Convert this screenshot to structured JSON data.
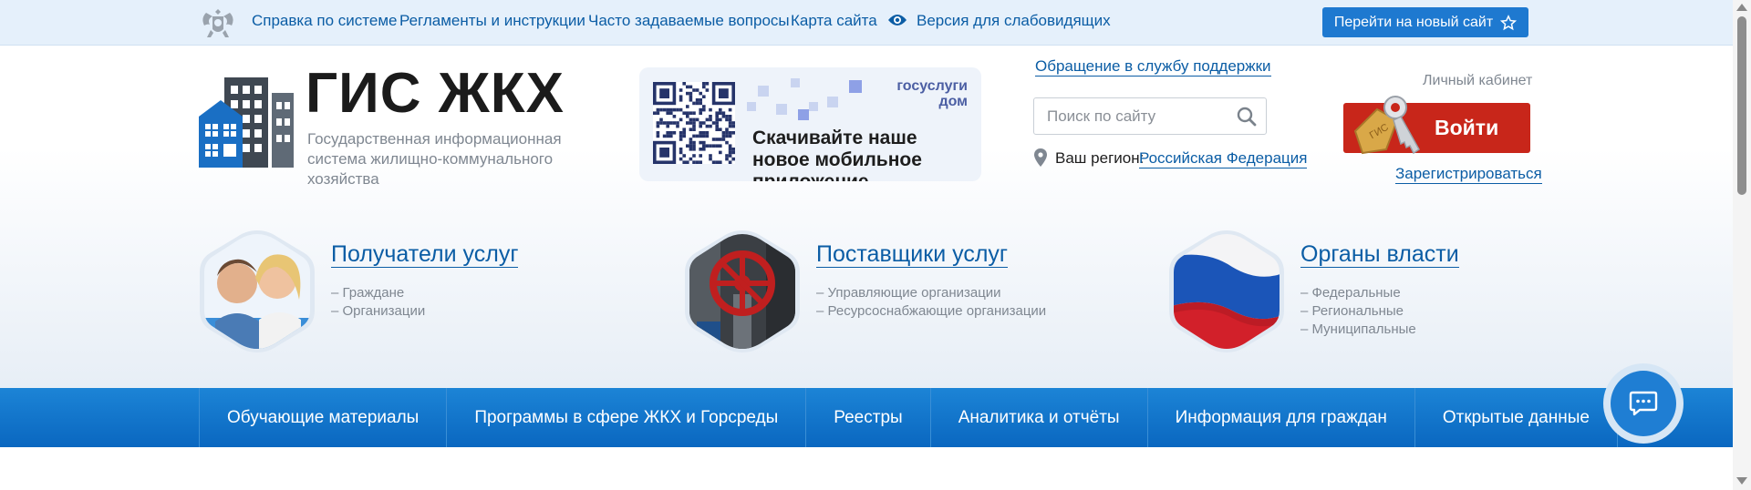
{
  "topbar": {
    "links": [
      "Справка по системе",
      "Регламенты и инструкции",
      "Часто задаваемые вопросы",
      "Карта сайта"
    ],
    "accessibility_label": "Версия для слабовидящих",
    "new_site_label": "Перейти на новый сайт"
  },
  "logo": {
    "title": "ГИС ЖКХ",
    "subtitle": "Государственная информационная система жилищно-коммунального хозяйства"
  },
  "promo": {
    "brand": "госуслуги дом",
    "text": "Скачивайте наше новое мобильное приложение"
  },
  "support": {
    "link": "Обращение в службу поддержки",
    "search_placeholder": "Поиск по сайту",
    "region_label": "Ваш регион:",
    "region_value": "Российская Федерация"
  },
  "account": {
    "cabinet_label": "Личный кабинет",
    "login_label": "Войти",
    "register_label": "Зарегистрироваться"
  },
  "audiences": [
    {
      "title": "Получатели услуг",
      "items": [
        "– Граждане",
        "– Организации"
      ]
    },
    {
      "title": "Поставщики услуг",
      "items": [
        "– Управляющие организации",
        "– Ресурсоснабжающие организации"
      ]
    },
    {
      "title": "Органы власти",
      "items": [
        "– Федеральные",
        "– Региональные",
        "– Муниципальные"
      ]
    }
  ],
  "nav": [
    "Обучающие материалы",
    "Программы в сфере ЖКХ и Горсреды",
    "Реестры",
    "Аналитика и отчёты",
    "Информация для граждан",
    "Открытые данные"
  ],
  "colors": {
    "accent": "#0b5da5",
    "nav_blue": "#1275cc",
    "login_red": "#c8261a",
    "topbar_bg": "#e5f0fb"
  },
  "icons": [
    "emblem-icon",
    "eye-icon",
    "star-icon",
    "building-logo-icon",
    "qr-code",
    "search-icon",
    "map-pin-icon",
    "key-icon",
    "chat-icon"
  ]
}
